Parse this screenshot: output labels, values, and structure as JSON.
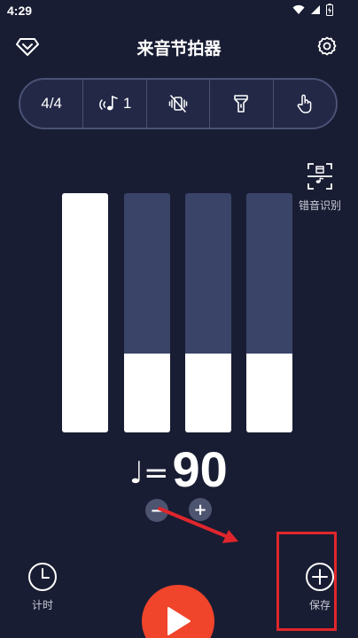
{
  "status_bar": {
    "time": "4:29",
    "icons": [
      "wifi-icon",
      "signal-icon",
      "battery-icon"
    ]
  },
  "header": {
    "title": "来音节拍器",
    "left_icon": "vip-diamond-icon",
    "right_icon": "gear-icon"
  },
  "toolbar": {
    "items": [
      {
        "label": "4/4",
        "icon": null
      },
      {
        "label": "1",
        "icon": "sound-note-icon"
      },
      {
        "label": "",
        "icon": "vibration-off-icon"
      },
      {
        "label": "",
        "icon": "flashlight-icon"
      },
      {
        "label": "",
        "icon": "tap-hand-icon"
      }
    ]
  },
  "error_recognition": {
    "label": "错音识别",
    "icon": "scan-note-icon"
  },
  "beats": [
    {
      "level": 1.0,
      "active": true
    },
    {
      "level": 0.33,
      "active": false
    },
    {
      "level": 0.33,
      "active": false
    },
    {
      "level": 0.33,
      "active": false
    }
  ],
  "tempo": {
    "note_symbol": "♩=",
    "bpm": "90",
    "decrease_label": "−",
    "increase_label": "+"
  },
  "bottom": {
    "timer_label": "计时",
    "save_label": "保存",
    "play_icon": "play-icon"
  },
  "colors": {
    "background": "#191d33",
    "bar_track": "#3a4468",
    "bar_fill": "#ffffff",
    "play_button": "#f0442b",
    "annotation": "#e0262c"
  }
}
